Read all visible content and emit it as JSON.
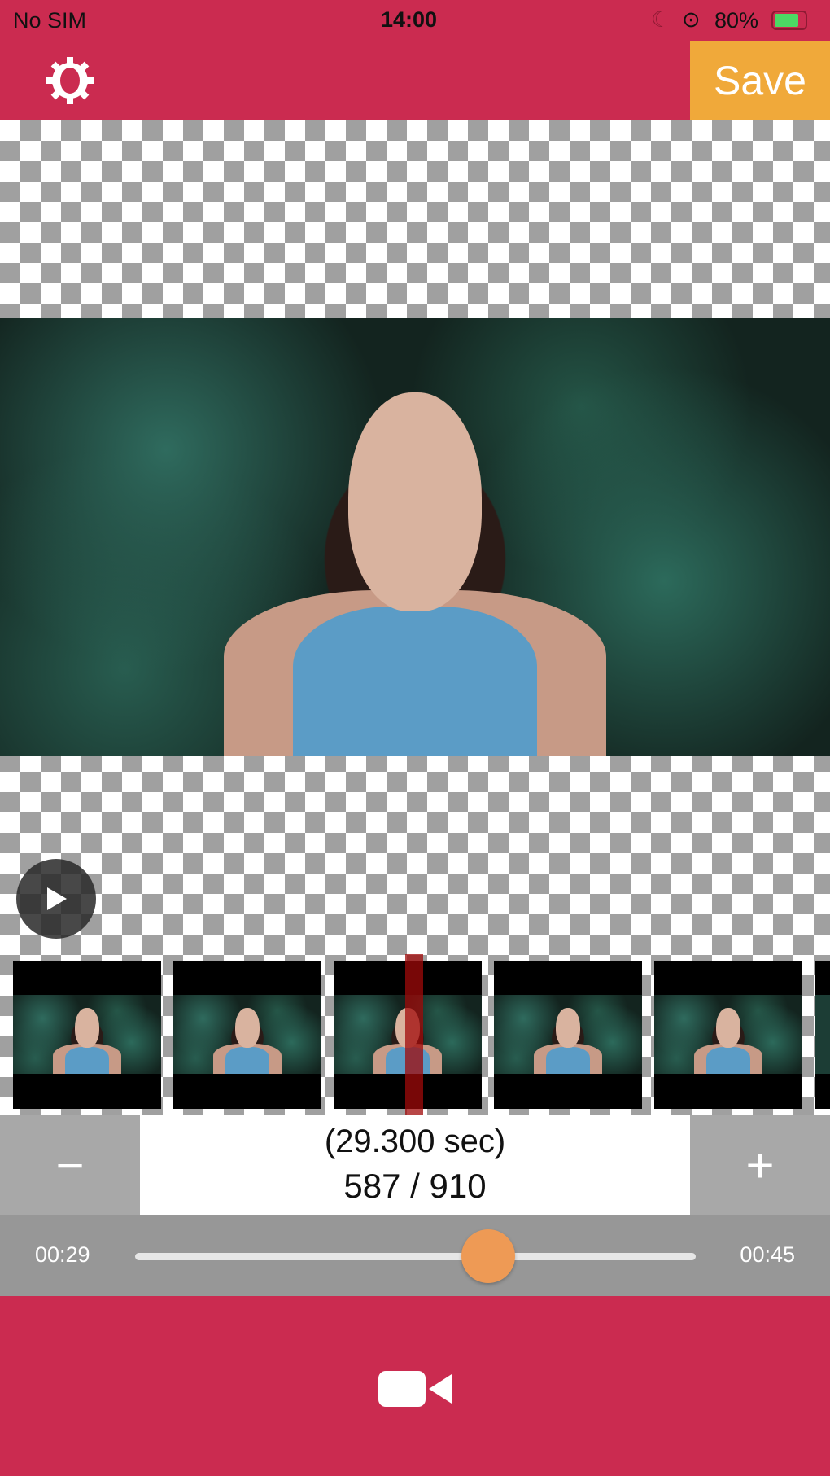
{
  "status_bar": {
    "carrier": "No SIM",
    "time": "14:00",
    "battery": "80%"
  },
  "header": {
    "save_label": "Save",
    "settings_icon": "gear-icon"
  },
  "player": {
    "play_icon": "play-icon"
  },
  "frame": {
    "seconds": "(29.300 sec)",
    "counter": "587 / 910",
    "minus_label": "−",
    "plus_label": "+"
  },
  "slider": {
    "start": "00:29",
    "end": "00:45",
    "value_fraction": 0.63
  },
  "footer": {
    "record_icon": "video-camera-icon"
  },
  "colors": {
    "brand": "#cb2b50",
    "save": "#f0a93a",
    "thumb": "#ee9a55"
  }
}
